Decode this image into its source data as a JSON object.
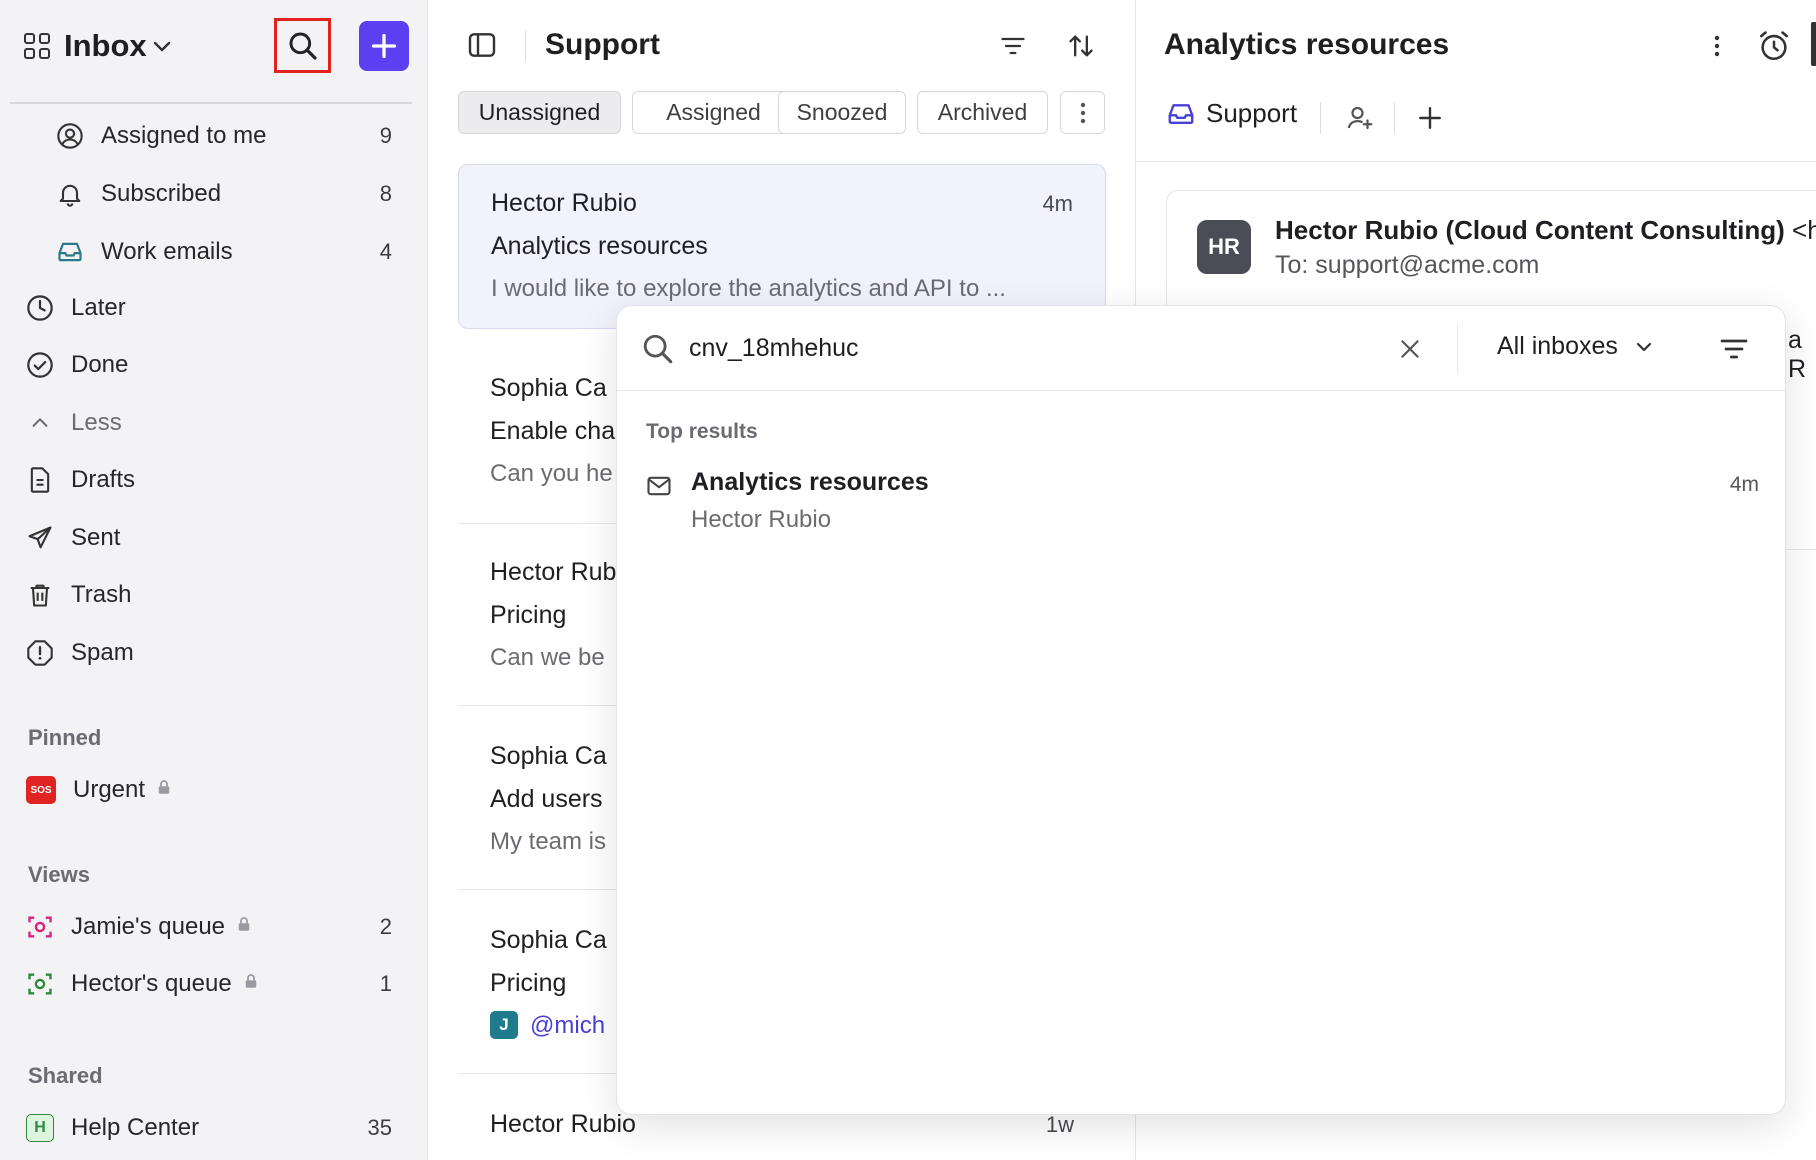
{
  "sidebar": {
    "title": "Inbox",
    "items": [
      {
        "label": "Assigned to me",
        "count": "9"
      },
      {
        "label": "Subscribed",
        "count": "8"
      },
      {
        "label": "Work emails",
        "count": "4"
      },
      {
        "label": "Later",
        "count": ""
      },
      {
        "label": "Done",
        "count": ""
      },
      {
        "label": "Less",
        "count": ""
      },
      {
        "label": "Drafts",
        "count": ""
      },
      {
        "label": "Sent",
        "count": ""
      },
      {
        "label": "Trash",
        "count": ""
      },
      {
        "label": "Spam",
        "count": ""
      }
    ],
    "pinned_label": "Pinned",
    "pinned": [
      {
        "label": "Urgent",
        "icon_text": "SOS"
      }
    ],
    "views_label": "Views",
    "views": [
      {
        "label": "Jamie's queue",
        "count": "2"
      },
      {
        "label": "Hector's queue",
        "count": "1"
      }
    ],
    "shared_label": "Shared",
    "shared": [
      {
        "label": "Help Center",
        "count": "35",
        "icon_text": "H"
      }
    ]
  },
  "list": {
    "title": "Support",
    "tabs": [
      "Unassigned",
      "Assigned",
      "Snoozed",
      "Archived"
    ],
    "conversations": [
      {
        "name": "Hector Rubio",
        "subject": "Analytics resources",
        "preview": "I would like to explore the analytics and API to ...",
        "time": "4m"
      },
      {
        "name": "Sophia Ca",
        "subject": "Enable cha",
        "preview": "Can you he",
        "time": ""
      },
      {
        "name": "Hector Rub",
        "subject": "Pricing",
        "preview": "Can we be",
        "time": ""
      },
      {
        "name": "Sophia Ca",
        "subject": "Add users",
        "preview": "My team is",
        "time": ""
      },
      {
        "name": "Sophia Ca",
        "subject": "Pricing",
        "preview": "@mich",
        "time": "",
        "avatar_text": "J"
      },
      {
        "name": "Hector Rubio",
        "subject": "",
        "preview": "",
        "time": "1w"
      }
    ]
  },
  "detail": {
    "title": "Analytics resources",
    "inbox": "Support",
    "avatar": "HR",
    "sender": "Hector Rubio (Cloud Content Consulting)",
    "sender_email": "<he",
    "to": "To: support@acme.com",
    "peek_text": "a R"
  },
  "search": {
    "query": "cnv_18mhehuc",
    "scope": "All inboxes",
    "section": "Top results",
    "results": [
      {
        "title": "Analytics resources",
        "subtitle": "Hector Rubio",
        "time": "4m"
      }
    ]
  },
  "colors": {
    "accent": "#5b3ff0",
    "highlight": "#e0241d",
    "sidebar_bg": "#f3f3f5"
  }
}
